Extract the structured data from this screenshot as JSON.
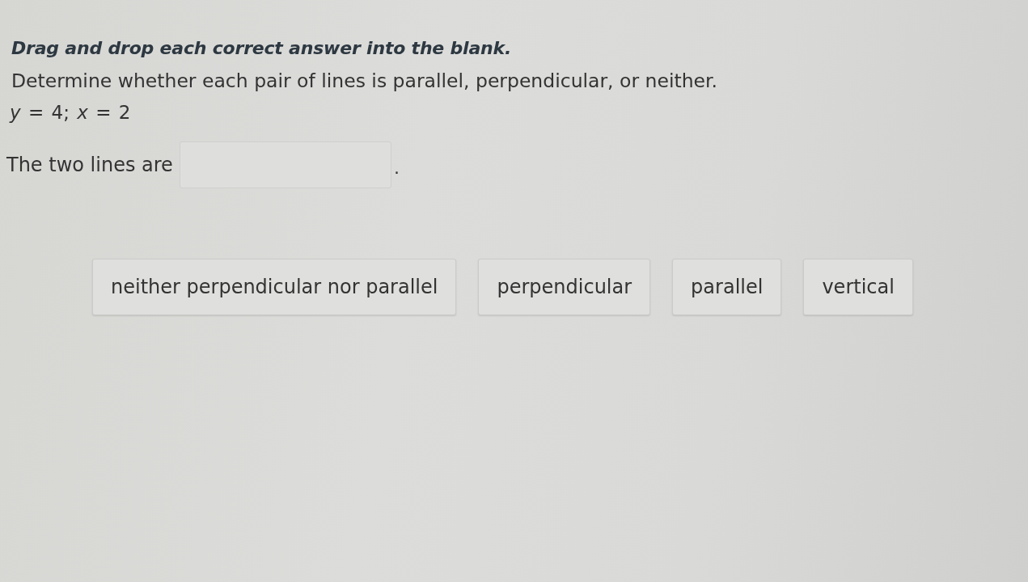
{
  "instruction": "Drag and drop each correct answer into the blank.",
  "question": "Determine whether each pair of lines is parallel, perpendicular, or neither.",
  "equation": "*y* = 4; *x* = 2",
  "answer_sentence": {
    "prefix": "The two lines are",
    "suffix": "."
  },
  "answer_choices": [
    "neither perpendicular nor parallel",
    "perpendicular",
    "parallel",
    "vertical"
  ]
}
